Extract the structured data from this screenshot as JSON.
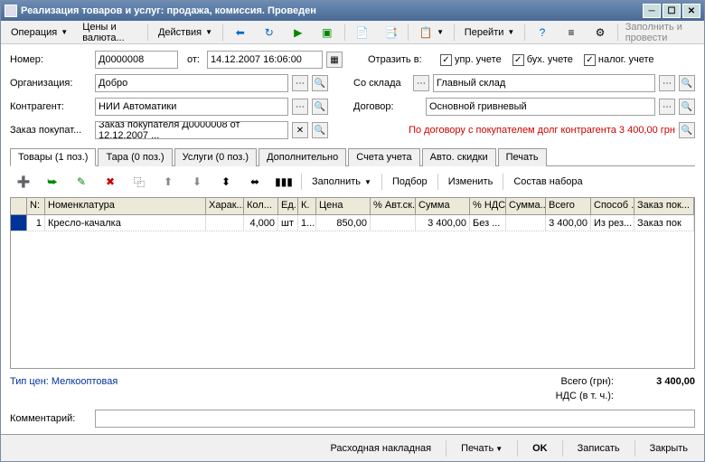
{
  "title": "Реализация товаров и услуг: продажа, комиссия. Проведен",
  "menu": {
    "operation": "Операция",
    "prices": "Цены и валюта...",
    "actions": "Действия",
    "goto": "Перейти",
    "fill_post": "Заполнить и провести"
  },
  "labels": {
    "number": "Номер:",
    "from": "от:",
    "organization": "Организация:",
    "contractor": "Контрагент:",
    "order": "Заказ покупат...",
    "reflect_in": "Отразить в:",
    "mgmt_acc": "упр. учете",
    "acc_acc": "бух. учете",
    "tax_acc": "налог. учете",
    "from_warehouse": "Со склада",
    "contract": "Договор:",
    "comment": "Комментарий:",
    "price_type": "Тип цен: Мелкооптовая",
    "total_label": "Всего (грн):",
    "vat_label": "НДС (в т. ч.):"
  },
  "values": {
    "number": "Д0000008",
    "date": "14.12.2007 16:06:00",
    "organization": "Добро",
    "contractor": "НИИ Автоматики",
    "order": "Заказ покупателя Д0000008 от 12.12.2007 ...",
    "warehouse": "Главный склад",
    "contract": "Основной гривневый",
    "comment": "",
    "total": "3 400,00",
    "vat": ""
  },
  "warning": "По договору с покупателем долг контрагента 3 400,00 грн",
  "tabs": {
    "goods": "Товары (1 поз.)",
    "tara": "Тара (0 поз.)",
    "services": "Услуги (0 поз.)",
    "extra": "Дополнительно",
    "accounts": "Счета учета",
    "auto_discounts": "Авто. скидки",
    "print": "Печать"
  },
  "tab_toolbar": {
    "fill": "Заполнить",
    "select": "Подбор",
    "change": "Изменить",
    "set_content": "Состав набора"
  },
  "grid_headers": {
    "n": "N:",
    "nomenclature": "Номенклатура",
    "characteristic": "Харак...",
    "qty": "Кол...",
    "unit": "Ед.",
    "k": "К.",
    "price": "Цена",
    "auto_disc": "% Авт.ск.",
    "sum": "Сумма",
    "vat_pct": "% НДС",
    "vat_sum": "Сумма...",
    "total": "Всего",
    "method": "Способ ...",
    "order": "Заказ пок..."
  },
  "grid_row": {
    "n": "1",
    "nomenclature": "Кресло-качалка",
    "characteristic": "",
    "qty": "4,000",
    "unit": "шт",
    "k": "1...",
    "price": "850,00",
    "auto_disc": "",
    "sum": "3 400,00",
    "vat_pct": "Без ...",
    "vat_sum": "",
    "total": "3 400,00",
    "method": "Из рез...",
    "order": "Заказ пок"
  },
  "bottom": {
    "invoice": "Расходная накладная",
    "print": "Печать",
    "ok": "OK",
    "save": "Записать",
    "close": "Закрыть"
  },
  "chart_data": {
    "type": "table",
    "columns": [
      "N",
      "Номенклатура",
      "Харак.",
      "Кол.",
      "Ед.",
      "К.",
      "Цена",
      "% Авт.ск.",
      "Сумма",
      "% НДС",
      "Сумма НДС",
      "Всего",
      "Способ",
      "Заказ"
    ],
    "rows": [
      [
        1,
        "Кресло-качалка",
        "",
        4.0,
        "шт",
        1,
        850.0,
        "",
        3400.0,
        "Без",
        "",
        3400.0,
        "Из рез",
        "Заказ пок"
      ]
    ]
  }
}
